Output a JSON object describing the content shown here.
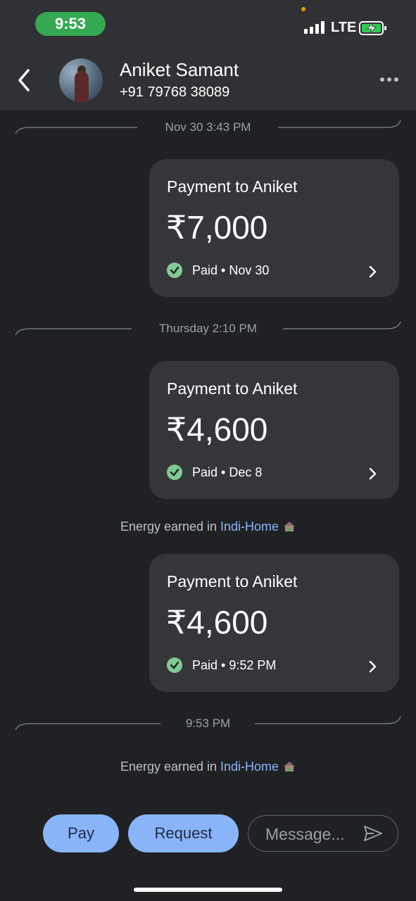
{
  "status_bar": {
    "time": "9:53",
    "network": "LTE"
  },
  "header": {
    "name": "Aniket Samant",
    "phone": "+91 79768 38089"
  },
  "dividers": [
    "Nov 30 3:43 PM",
    "Thursday 2:10 PM",
    "9:53 PM"
  ],
  "payments": [
    {
      "title": "Payment to Aniket",
      "amount": "₹7,000",
      "status": "Paid • Nov 30"
    },
    {
      "title": "Payment to Aniket",
      "amount": "₹4,600",
      "status": "Paid • Dec 8"
    },
    {
      "title": "Payment to Aniket",
      "amount": "₹4,600",
      "status": "Paid • 9:52 PM"
    }
  ],
  "energy": [
    {
      "prefix": "Energy earned in ",
      "link": "Indi-Home"
    },
    {
      "prefix": "Energy earned in ",
      "link": "Indi-Home"
    }
  ],
  "footer": {
    "pay_label": "Pay",
    "request_label": "Request",
    "message_placeholder": "Message..."
  },
  "colors": {
    "accent": "#8ab4f8",
    "paid_check": "#81c995",
    "time_pill": "#34a853"
  },
  "icons": [
    "back-arrow-icon",
    "more-icon",
    "check-icon",
    "chevron-right-icon",
    "house-icon",
    "send-icon",
    "battery-charging-icon",
    "signal-icon"
  ]
}
